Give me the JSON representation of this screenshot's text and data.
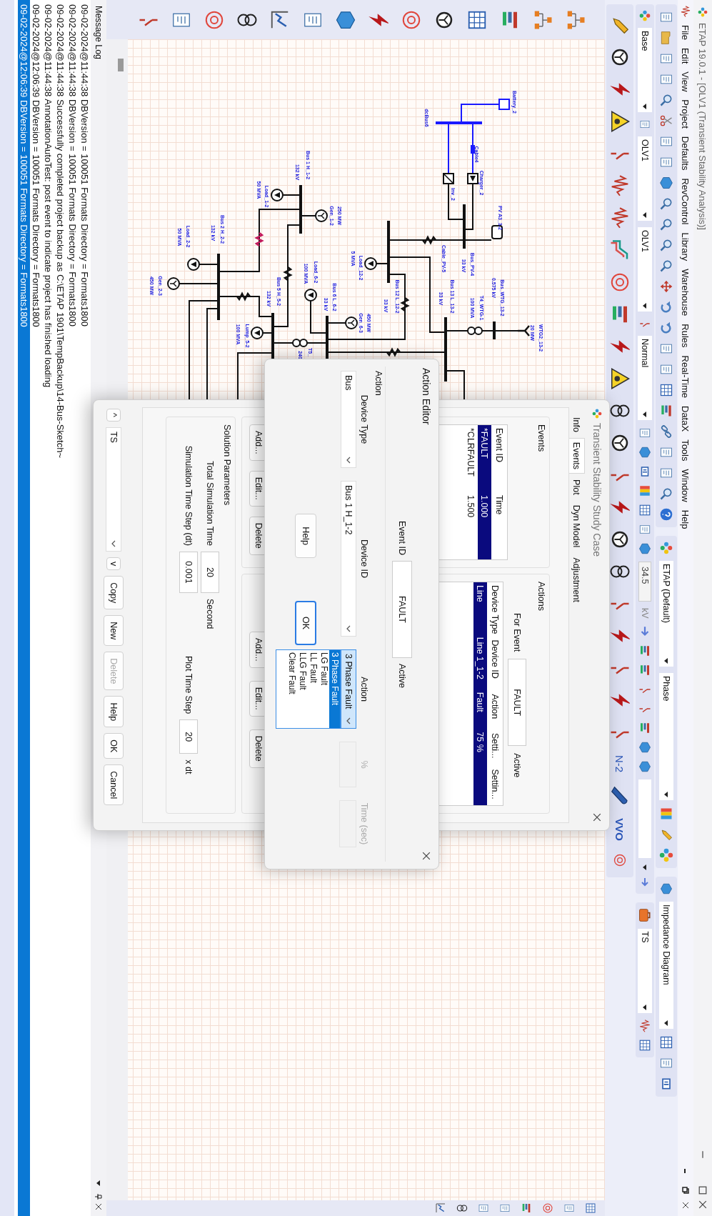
{
  "window": {
    "title": "ETAP 19.0.1  - [OLV1 (Transient Stability Analysis)]"
  },
  "menu": [
    "File",
    "Edit",
    "View",
    "Project",
    "Defaults",
    "RevControl",
    "Library",
    "Warehouse",
    "Rules",
    "Real-Time",
    "DataX",
    "Tools",
    "Window",
    "Help"
  ],
  "toolbar": {
    "project": "ETAP (Default)",
    "phase": "Phase",
    "view": "Impedance Diagram",
    "base": "Base",
    "presentation": "OLV1",
    "configuration": "OLV1",
    "status": "Normal",
    "voltage": "34.5",
    "voltage_unit": "kV",
    "study_case": "TS",
    "n2": "N-2",
    "vvo": "VVO"
  },
  "diagram": {
    "labels": [
      "Battery_2",
      "dcBus6",
      "Cable4",
      "Charger_2",
      "Inv_2",
      "PV A3_3-2",
      "Bus_PV-4",
      "33 kV",
      "Cable_PV-5",
      "Bus 12 L_12-2",
      "33 kV",
      "Load_12-2",
      "5 MVA",
      "Bus 13 L_13-2",
      "33 kV",
      "Bus_WTG_13-2",
      "0.575 kV",
      "T4_WTG-1",
      "100 MVA",
      "WTG2_13-2",
      "20 MW",
      "Bus 1 H_1-2",
      "132 kV",
      "250 MW",
      "Gen_1-2",
      "Load_1-2",
      "50 MVA",
      "Bus 2 H_2-2",
      "132 kV",
      "Load_2-2",
      "50 MVA",
      "Gen_2-3",
      "450 MW",
      "Bus 5 H_5-2",
      "132 kV",
      "Lump_5-2",
      "100 MVA",
      "Load_6-2",
      "100 MVA",
      "Bus 6 L_6-2",
      "33 kV",
      "450 MW",
      "Gen_6-3",
      "T5_",
      "240"
    ]
  },
  "study_case": {
    "title": "Transient Stability Study Case",
    "tabs": [
      {
        "label": "Info",
        "selected": false
      },
      {
        "label": "Events",
        "selected": true
      },
      {
        "label": "Plot",
        "selected": false
      },
      {
        "label": "Dyn Model",
        "selected": false
      },
      {
        "label": "Adjustment",
        "selected": false
      }
    ],
    "events": {
      "label": "Events",
      "header": [
        "Event ID",
        "Time"
      ],
      "entries": [
        {
          "values": [
            "*FAULT",
            "1.000"
          ],
          "selected": true
        },
        {
          "values": [
            "*CLRFAULT",
            "1.500"
          ],
          "selected": false
        }
      ],
      "buttons": [
        "Add...",
        "Edit...",
        "Delete"
      ]
    },
    "actions": {
      "label": "Actions",
      "for_event_label": "For Event",
      "for_event_value": "FAULT",
      "active_label": "Active",
      "header": [
        "Device Type",
        "Device ID",
        "Action",
        "Setti...",
        "Settin..."
      ],
      "entries": [
        {
          "values": [
            "Line",
            "Line 1_1-2",
            "Fault",
            "75 %"
          ],
          "selected": true
        }
      ],
      "buttons": [
        "Add...",
        "Edit...",
        "Delete"
      ]
    },
    "solution": {
      "label": "Solution Parameters",
      "total_time_label": "Total Simulation Time",
      "total_time_value": "20",
      "total_time_unit": "Second",
      "step_label": "Simulation Time Step (dt)",
      "step_value": "0.001",
      "plot_step_label": "Plot Time Step",
      "plot_step_value": "20",
      "plot_step_unit": "x dt"
    },
    "footer": {
      "prev": "^",
      "case": "TS",
      "next": "v",
      "buttons": [
        {
          "label": "Copy",
          "disabled": false
        },
        {
          "label": "New",
          "disabled": false
        },
        {
          "label": "Delete",
          "disabled": true
        },
        {
          "label": "Help",
          "disabled": false
        },
        {
          "label": "OK",
          "disabled": false
        },
        {
          "label": "Cancel",
          "disabled": false
        }
      ]
    }
  },
  "action_editor": {
    "title": "Action Editor",
    "event_id_label": "Event ID",
    "event_id_value": "FAULT",
    "active_label": "Active",
    "group_label": "Action",
    "device_type_label": "Device Type",
    "device_type_value": "Bus",
    "device_id_label": "Device ID",
    "device_id_value": "Bus 1 H_1-2",
    "action_label": "Action",
    "action": {
      "value": "3 Phase Fault",
      "expanded": true,
      "options": [
        {
          "label": "3 Phase Fault",
          "selected": true
        },
        {
          "label": "LG Fault",
          "selected": false
        },
        {
          "label": "LL Fault",
          "selected": false
        },
        {
          "label": "LLG Fault",
          "selected": false
        },
        {
          "label": "Clear Fault",
          "selected": false
        }
      ]
    },
    "setting": {
      "label": "%",
      "disabled": true
    },
    "time": {
      "label": "Time (sec)",
      "disabled": true
    },
    "buttons": [
      {
        "label": "Help",
        "focused": false
      },
      {
        "label": "OK",
        "focused": true
      }
    ]
  },
  "message_log": {
    "title": "Message Log",
    "lines": [
      {
        "text": "09-02-2024@11:44:38 DBVersion = 100051 Formats Directory = Formats1800",
        "selected": false
      },
      {
        "text": "09-02-2024@11:44:38 DBVersion = 100051 Formats Directory = Formats1800",
        "selected": false
      },
      {
        "text": "09-02-2024@11:44:38 Successfully completed project backup as C:\\ETAP 1901\\TempBackup\\14-Bus-Sketch~",
        "selected": false
      },
      {
        "text": "09-02-2024@11:44:38 AnnotationAutoTest: post event to indicate project has finished loading",
        "selected": false
      },
      {
        "text": "09-02-2024@12:06:39 DBVersion = 100051 Formats Directory = Formats1800",
        "selected": false
      },
      {
        "text": "09-02-2024@12:06:39 DBVersion = 100051 Formats Directory = Formats1800",
        "selected": true
      }
    ]
  }
}
